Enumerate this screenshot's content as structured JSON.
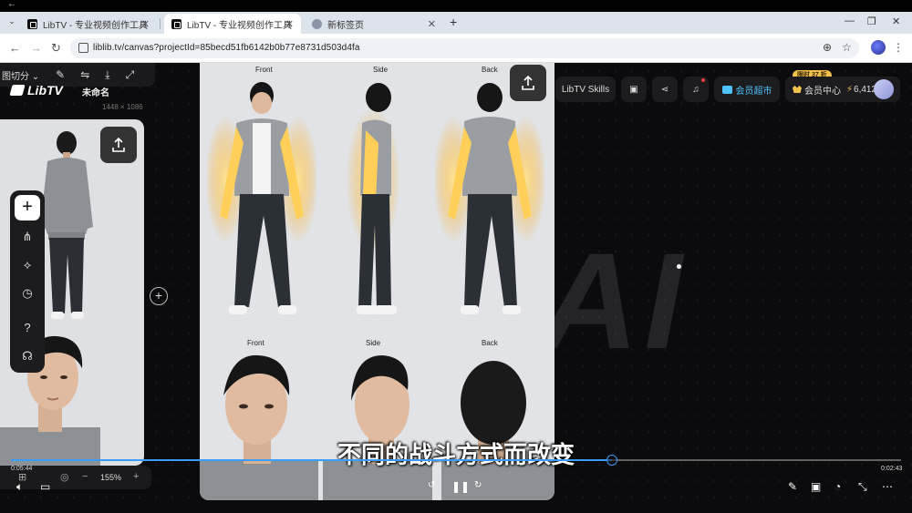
{
  "browser": {
    "back_glyph": "←",
    "tabs": [
      {
        "title": "LibTV - 专业视频创作工具",
        "active": false
      },
      {
        "title": "LibTV - 专业视频创作工具",
        "active": true
      },
      {
        "title": "新标签页",
        "active": false
      }
    ],
    "new_tab": "+",
    "url": "liblib.tv/canvas?projectId=85becd51fb6142b0b77e8731d503d4fa"
  },
  "canvas": {
    "toolbar_label": "图切分",
    "brand": "LibTV",
    "project_name": "未命名",
    "image_size": "1448 × 1086",
    "watermark": "云稀AI",
    "main_views_top": [
      "Front",
      "Side",
      "Back"
    ],
    "main_views_bottom": [
      "Front",
      "Side",
      "Back"
    ]
  },
  "right_toolbar": {
    "skills": "LibTV Skills",
    "member_store": "会员超市",
    "promo": "限时 37 折",
    "member_center": "会员中心",
    "credits": "6,412"
  },
  "video": {
    "subtitle": "不同的战斗方式而改变",
    "current_time": "0:05:44",
    "total_time": "0:02:43",
    "progress_fraction": 0.675,
    "zoom": "155%",
    "accent": "#3b9cff"
  }
}
